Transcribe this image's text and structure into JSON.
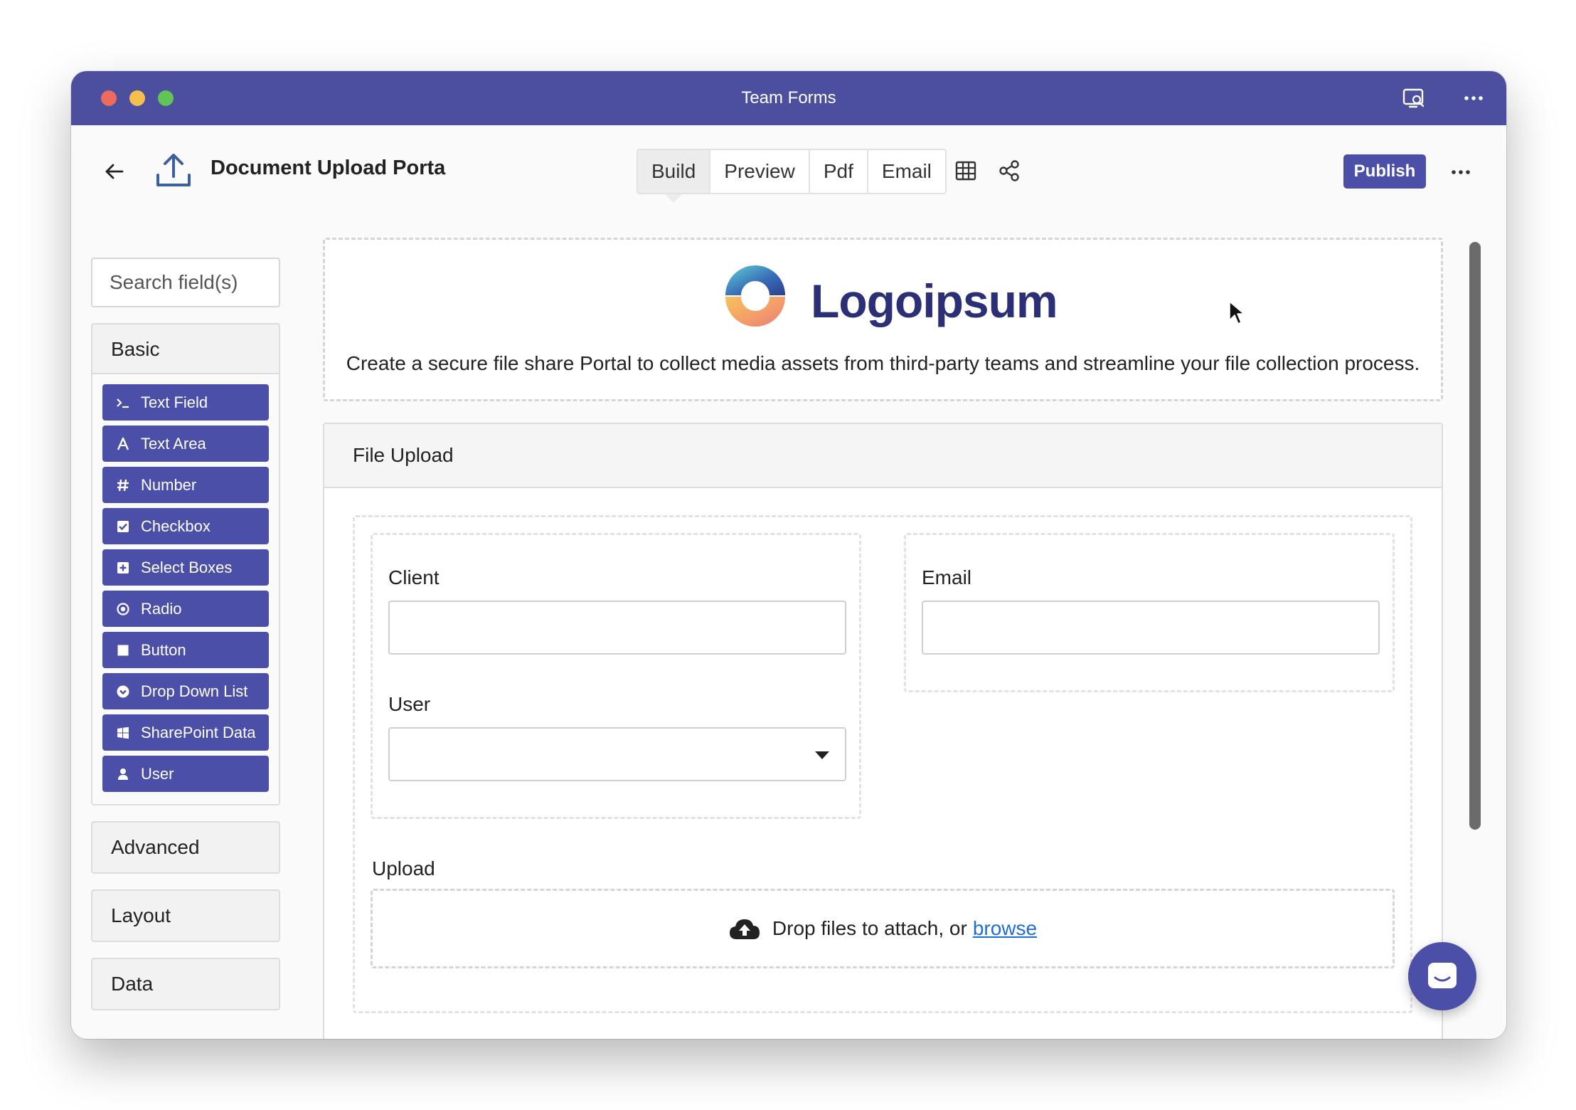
{
  "window": {
    "title": "Team Forms"
  },
  "header": {
    "doc_title": "Document Upload Porta",
    "tabs": [
      "Build",
      "Preview",
      "Pdf",
      "Email"
    ],
    "active_tab": "Build",
    "publish_label": "Publish"
  },
  "sidebar": {
    "search_placeholder": "Search field(s)",
    "basic_label": "Basic",
    "basic_items": [
      {
        "label": "Text Field",
        "icon": "terminal-icon"
      },
      {
        "label": "Text Area",
        "icon": "font-icon"
      },
      {
        "label": "Number",
        "icon": "hash-icon"
      },
      {
        "label": "Checkbox",
        "icon": "checkbox-icon"
      },
      {
        "label": "Select Boxes",
        "icon": "plus-square-icon"
      },
      {
        "label": "Radio",
        "icon": "radio-icon"
      },
      {
        "label": "Button",
        "icon": "stop-icon"
      },
      {
        "label": "Drop Down List",
        "icon": "chevron-circle-down-icon"
      },
      {
        "label": "SharePoint Data",
        "icon": "windows-icon"
      },
      {
        "label": "User",
        "icon": "user-icon"
      }
    ],
    "advanced_label": "Advanced",
    "layout_label": "Layout",
    "data_label": "Data"
  },
  "banner": {
    "logo_text": "Logoipsum",
    "description": "Create a secure file share Portal to collect media assets from third-party teams and streamline your file collection process."
  },
  "panel": {
    "title": "File Upload",
    "client_label": "Client",
    "email_label": "Email",
    "user_label": "User",
    "upload_label": "Upload",
    "drop_text": "Drop files to attach, or",
    "browse_text": "browse"
  },
  "colors": {
    "titlebar": "#4b4f9e",
    "accent": "#4b4fa8",
    "link": "#1f6fd1"
  }
}
